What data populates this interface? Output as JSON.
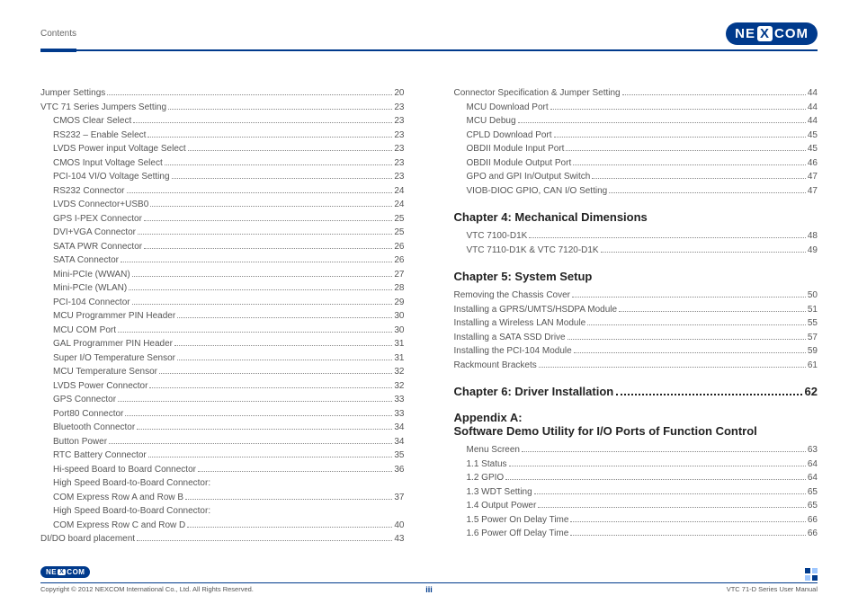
{
  "header": {
    "section_label": "Contents",
    "brand_pre": "NE",
    "brand_mid": "X",
    "brand_post": "COM"
  },
  "left": {
    "items": [
      {
        "indent": 0,
        "label": "Jumper Settings",
        "pg": "20"
      },
      {
        "indent": 0,
        "label": "VTC 71 Series Jumpers Setting",
        "pg": "23"
      },
      {
        "indent": 1,
        "label": "CMOS Clear Select",
        "pg": "23"
      },
      {
        "indent": 1,
        "label": "RS232 – Enable Select",
        "pg": "23"
      },
      {
        "indent": 1,
        "label": "LVDS Power input Voltage Select",
        "pg": "23"
      },
      {
        "indent": 1,
        "label": "CMOS Input Voltage Select",
        "pg": "23"
      },
      {
        "indent": 1,
        "label": "PCI-104 VI/O Voltage Setting",
        "pg": "23"
      },
      {
        "indent": 1,
        "label": "RS232 Connector",
        "pg": "24"
      },
      {
        "indent": 1,
        "label": "LVDS Connector+USB0",
        "pg": "24"
      },
      {
        "indent": 1,
        "label": "GPS I-PEX Connector",
        "pg": "25"
      },
      {
        "indent": 1,
        "label": "DVI+VGA  Connector",
        "pg": "25"
      },
      {
        "indent": 1,
        "label": "SATA PWR Connector",
        "pg": "26"
      },
      {
        "indent": 1,
        "label": "SATA Connector",
        "pg": "26"
      },
      {
        "indent": 1,
        "label": "Mini-PCIe (WWAN)",
        "pg": "27"
      },
      {
        "indent": 1,
        "label": "Mini-PCIe (WLAN)",
        "pg": "28"
      },
      {
        "indent": 1,
        "label": "PCI-104 Connector",
        "pg": "29"
      },
      {
        "indent": 1,
        "label": "MCU Programmer PIN Header",
        "pg": "30"
      },
      {
        "indent": 1,
        "label": "MCU COM Port",
        "pg": "30"
      },
      {
        "indent": 1,
        "label": "GAL Programmer PIN Header",
        "pg": "31"
      },
      {
        "indent": 1,
        "label": "Super I/O Temperature Sensor",
        "pg": "31"
      },
      {
        "indent": 1,
        "label": "MCU Temperature Sensor",
        "pg": "32"
      },
      {
        "indent": 1,
        "label": "LVDS Power Connector",
        "pg": "32"
      },
      {
        "indent": 1,
        "label": "GPS Connector",
        "pg": "33"
      },
      {
        "indent": 1,
        "label": "Port80 Connector",
        "pg": "33"
      },
      {
        "indent": 1,
        "label": "Bluetooth Connector",
        "pg": "34"
      },
      {
        "indent": 1,
        "label": "Button Power",
        "pg": "34"
      },
      {
        "indent": 1,
        "label": "RTC Battery Connector",
        "pg": "35"
      },
      {
        "indent": 1,
        "label": "Hi-speed Board to Board Connector",
        "pg": "36"
      },
      {
        "indent": 1,
        "label": "High Speed Board-to-Board Connector:"
      },
      {
        "indent": 1,
        "label": "COM Express Row A and Row B",
        "pg": "37"
      },
      {
        "indent": 1,
        "label": "High Speed Board-to-Board Connector:"
      },
      {
        "indent": 1,
        "label": "COM Express Row C and Row D",
        "pg": "40"
      },
      {
        "indent": 0,
        "label": "DI/DO board placement",
        "pg": "43"
      }
    ]
  },
  "right": {
    "group1": {
      "items": [
        {
          "indent": 0,
          "label": "Connector Specification & Jumper Setting",
          "pg": "44"
        },
        {
          "indent": 1,
          "label": "MCU Download Port",
          "pg": "44"
        },
        {
          "indent": 1,
          "label": "MCU Debug",
          "pg": "44"
        },
        {
          "indent": 1,
          "label": "CPLD Download Port",
          "pg": "45"
        },
        {
          "indent": 1,
          "label": "OBDII Module Input Port",
          "pg": "45"
        },
        {
          "indent": 1,
          "label": "OBDII Module Output Port",
          "pg": "46"
        },
        {
          "indent": 1,
          "label": "GPO and GPI In/Output Switch",
          "pg": "47"
        },
        {
          "indent": 1,
          "label": "VIOB-DIOC GPIO, CAN I/O Setting",
          "pg": "47"
        }
      ]
    },
    "chapter4": {
      "title": "Chapter 4: Mechanical Dimensions",
      "items": [
        {
          "indent": 1,
          "label": "VTC 7100-D1K",
          "pg": "48"
        },
        {
          "indent": 1,
          "label": "VTC 7110-D1K & VTC 7120-D1K",
          "pg": "49"
        }
      ]
    },
    "chapter5": {
      "title": "Chapter 5: System Setup",
      "items": [
        {
          "indent": 0,
          "label": "Removing the Chassis Cover",
          "pg": "50"
        },
        {
          "indent": 0,
          "label": "Installing a GPRS/UMTS/HSDPA Module",
          "pg": "51"
        },
        {
          "indent": 0,
          "label": "Installing a Wireless LAN Module",
          "pg": "55"
        },
        {
          "indent": 0,
          "label": "Installing a SATA SSD Drive",
          "pg": "57"
        },
        {
          "indent": 0,
          "label": "Installing the PCI-104 Module",
          "pg": "59"
        },
        {
          "indent": 0,
          "label": "Rackmount Brackets",
          "pg": "61"
        }
      ]
    },
    "chapter6": {
      "title": "Chapter 6: Driver Installation",
      "pg": "62"
    },
    "appendixA": {
      "title_line1": "Appendix A:",
      "title_line2": "Software Demo Utility for I/O Ports of Function Control",
      "items": [
        {
          "indent": 1,
          "label": "Menu Screen",
          "pg": "63"
        },
        {
          "indent": 1,
          "label": "1.1  Status",
          "pg": "64"
        },
        {
          "indent": 1,
          "label": "1.2  GPIO",
          "pg": "64"
        },
        {
          "indent": 1,
          "label": "1.3  WDT Setting",
          "pg": "65"
        },
        {
          "indent": 1,
          "label": "1.4  Output Power",
          "pg": "65"
        },
        {
          "indent": 1,
          "label": "1.5  Power On Delay Time",
          "pg": "66"
        },
        {
          "indent": 1,
          "label": "1.6  Power Off Delay Time",
          "pg": "66"
        }
      ]
    }
  },
  "footer": {
    "copyright": "Copyright © 2012 NEXCOM International Co., Ltd. All Rights Reserved.",
    "page_number": "iii",
    "manual": "VTC 71-D Series User Manual"
  }
}
